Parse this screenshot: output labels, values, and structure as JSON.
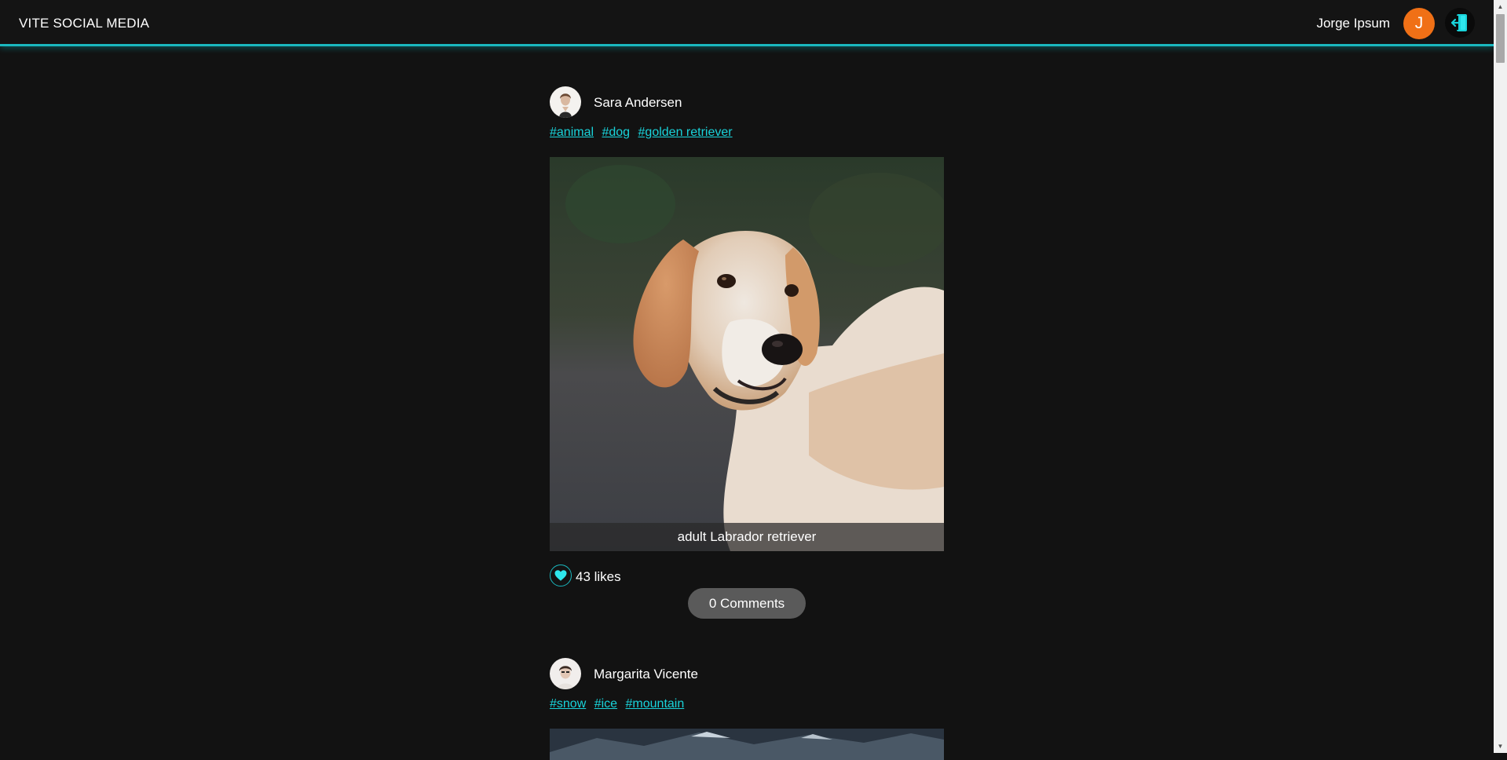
{
  "header": {
    "brand": "VITE SOCIAL MEDIA",
    "user_name": "Jorge Ipsum",
    "avatar_initial": "J",
    "logout_icon": "logout-door-icon",
    "accent_color": "#1ab8bf",
    "avatar_color": "#f07016"
  },
  "posts": [
    {
      "author": "Sara Andersen",
      "tags": [
        "#animal",
        "#dog",
        "#golden retriever"
      ],
      "caption": "adult Labrador retriever",
      "likes": "43 likes",
      "comments": "0 Comments"
    },
    {
      "author": "Margarita Vicente",
      "tags": [
        "#snow",
        "#ice",
        "#mountain"
      ]
    }
  ]
}
